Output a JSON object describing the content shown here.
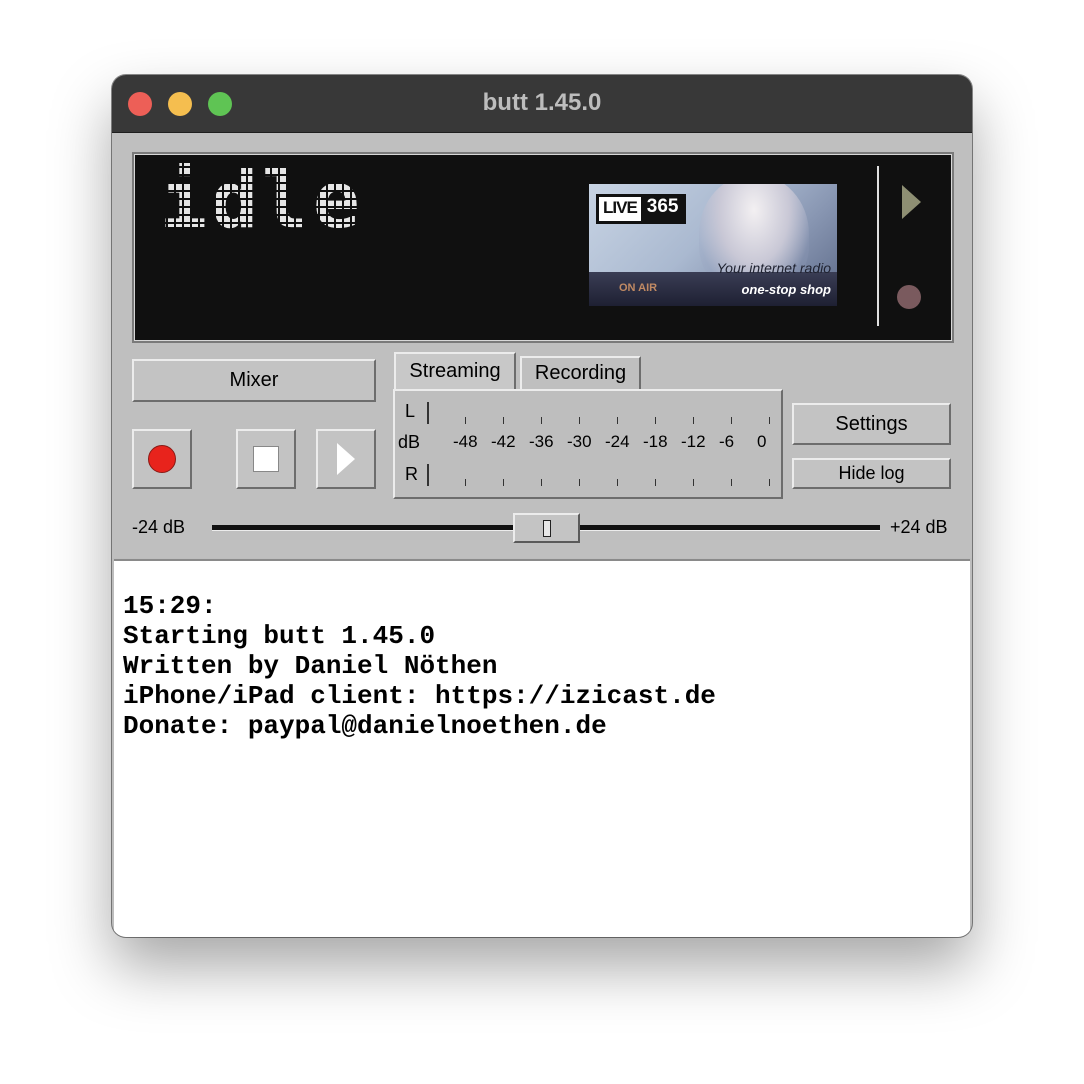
{
  "window": {
    "title": "butt 1.45.0"
  },
  "display": {
    "status": "idle",
    "ad": {
      "logo_live": "LIVE",
      "logo_num": "365",
      "tagline1": "Your internet radio",
      "tagline2": "one-stop shop",
      "onair": "ON AIR"
    }
  },
  "controls": {
    "mixer_label": "Mixer",
    "settings_label": "Settings",
    "hidelog_label": "Hide log"
  },
  "tabs": [
    {
      "label": "Streaming",
      "active": true
    },
    {
      "label": "Recording",
      "active": false
    }
  ],
  "meter": {
    "left_label": "L",
    "right_label": "R",
    "unit_label": "dB",
    "scale": [
      "-48",
      "-42",
      "-36",
      "-30",
      "-24",
      "-18",
      "-12",
      "-6",
      "0"
    ]
  },
  "gain": {
    "min_label": "-24 dB",
    "max_label": "+24 dB",
    "value_db": 0
  },
  "log": {
    "lines": [
      "15:29:",
      "Starting butt 1.45.0",
      "Written by Daniel Nöthen",
      "iPhone/iPad client: https://izicast.de",
      "Donate: paypal@danielnoethen.de"
    ]
  },
  "icons": {
    "close": "traffic-light-red",
    "minimize": "traffic-light-yellow",
    "zoom": "traffic-light-green",
    "record": "record-icon",
    "stop": "stop-icon",
    "play": "play-icon"
  },
  "colors": {
    "record": "#e8231c",
    "display_bg": "#101010",
    "titlebar": "#383838"
  }
}
